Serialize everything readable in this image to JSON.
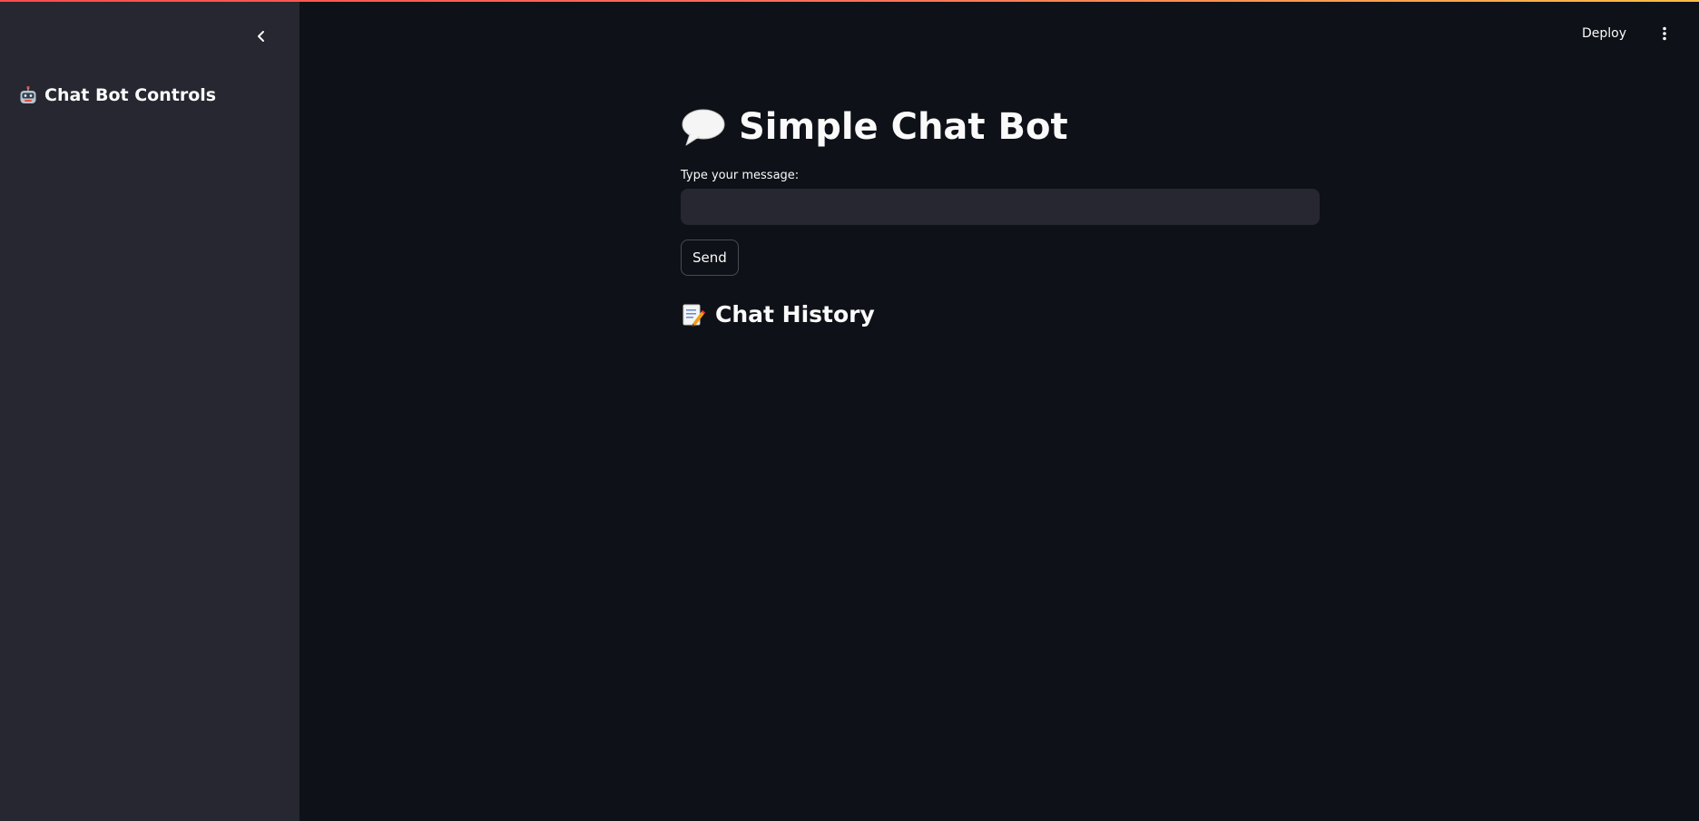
{
  "sidebar": {
    "collapse_icon": "chevron-left-icon",
    "title": "Chat Bot Controls",
    "title_icon": "robot-emoji-icon"
  },
  "header": {
    "deploy_label": "Deploy",
    "menu_icon": "vertical-dots-icon"
  },
  "main": {
    "title": "Simple Chat Bot",
    "title_icon": "speech-balloon-emoji-icon",
    "input_label": "Type your message:",
    "input_value": "",
    "send_label": "Send",
    "history_title": "Chat History",
    "history_icon": "memo-emoji-icon"
  },
  "colors": {
    "app_background": "#0e1117",
    "sidebar_background": "#262730",
    "input_background": "#262730",
    "text": "#fafafa",
    "top_stripe_start": "#ff4b4b",
    "top_stripe_end": "#ffbd45"
  }
}
